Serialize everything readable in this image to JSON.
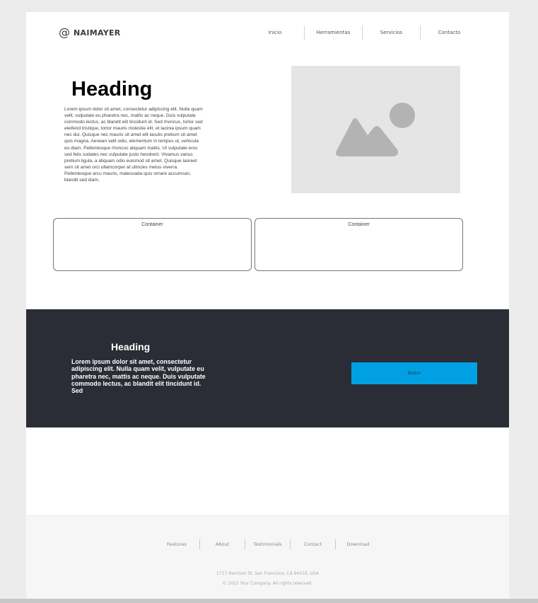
{
  "header": {
    "logo_icon": "@",
    "logo_text": "NAIMAYER",
    "nav": [
      "Inicio",
      "Herramientas",
      "Servicios",
      "Contacto"
    ]
  },
  "hero": {
    "heading": "Heading",
    "text": "Lorem ipsum dolor sit amet, consectetur adipiscing elit. Nulla quam velit, vulputate eu pharetra nec, mattis ac neque. Duis vulputate commodo lectus, ac blandit elit tincidunt id. Sed rhoncus, tortor sed eleifend tristique, tortor mauris molestie elit, et lacinia ipsum quam nec dui. Quisque nec mauris sit amet elit iaculis pretium sit amet quis magna. Aenean velit odio, elementum in tempus ut, vehicula eu diam. Pellentesque rhoncus aliquam mattis. Ut vulputate eros sed felis sodales nec vulputate justo hendrerit. Vivamus varius pretium ligula, a aliquam odio euismod sit amet. Quisque laoreet sem sit amet orci ullamcorper at ultricies metus viverra. Pellentesque arcu mauris, malesuada quis ornare accumsan, blandit sed diam.",
    "image_icon": "image-placeholder-icon"
  },
  "containers": [
    {
      "label": "Container"
    },
    {
      "label": "Container"
    }
  ],
  "dark_section": {
    "heading": "Heading",
    "text": "Lorem ipsum dolor sit amet, consectetur adipiscing elit. Nulla quam velit, vulputate eu pharetra nec, mattis ac neque. Duis vulputate commodo lectus, ac blandit elit tincidunt id. Sed",
    "button_label": "Button"
  },
  "footer": {
    "links": [
      "Features",
      "About",
      "Testimonials",
      "Contact",
      "Download"
    ],
    "address": "1717 Harrison St, San Francisco, CA 94103, USA",
    "copyright": "© 2022 Your Company.  All rights reserved."
  },
  "colors": {
    "background": "#ececec",
    "page": "#ffffff",
    "dark_band": "#2a2d35",
    "button": "#00a0e3",
    "image_placeholder": "#e5e5e5",
    "image_glyph": "#b3b3b3",
    "footer": "#f6f6f6"
  }
}
